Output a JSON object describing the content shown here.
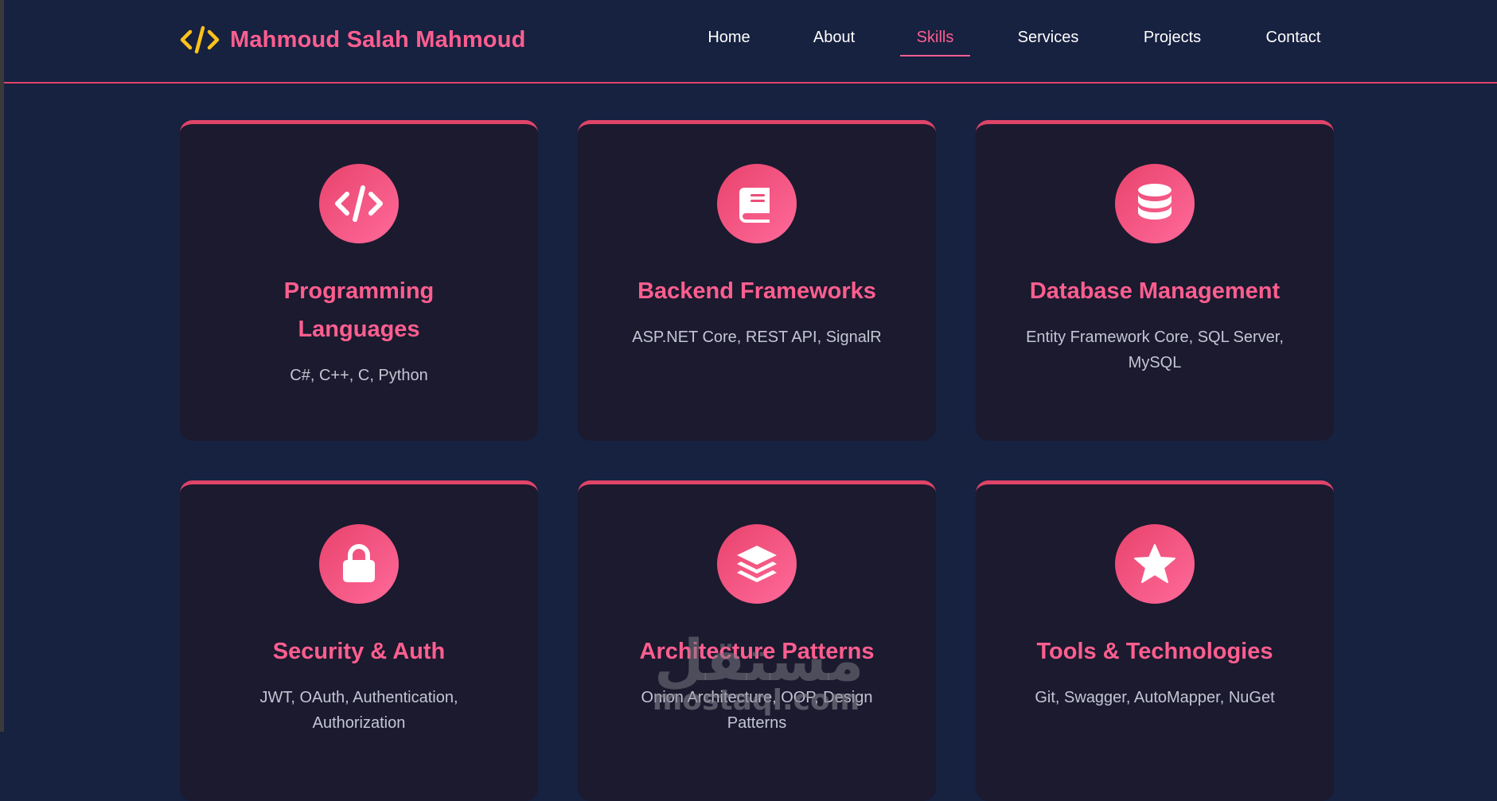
{
  "brand": {
    "name": "Mahmoud Salah Mahmoud",
    "icon": "code-icon",
    "color": "#ff5e8f",
    "icon_color": "#ffc21a"
  },
  "nav": {
    "items": [
      {
        "label": "Home"
      },
      {
        "label": "About"
      },
      {
        "label": "Skills"
      },
      {
        "label": "Services"
      },
      {
        "label": "Projects"
      },
      {
        "label": "Contact"
      }
    ],
    "active": "Skills"
  },
  "colors": {
    "background": "#172140",
    "card": "#1b1a2f",
    "accent": "#ff5e8f",
    "accent_border": "#e04468",
    "text_muted": "#c4c6d2"
  },
  "skills": [
    {
      "title": "Programming Languages",
      "description": "C#, C++, C, Python",
      "icon": "code-icon"
    },
    {
      "title": "Backend Frameworks",
      "description": "ASP.NET Core, REST API, SignalR",
      "icon": "book-icon"
    },
    {
      "title": "Database Management",
      "description": "Entity Framework Core, SQL Server, MySQL",
      "icon": "database-icon"
    },
    {
      "title": "Security & Auth",
      "description": "JWT, OAuth, Authentication, Authorization",
      "icon": "lock-icon"
    },
    {
      "title": "Architecture Patterns",
      "description": "Onion Architecture, OOP, Design Patterns",
      "icon": "layers-icon"
    },
    {
      "title": "Tools & Technologies",
      "description": "Git, Swagger, AutoMapper, NuGet",
      "icon": "star-icon"
    }
  ],
  "watermark": {
    "arabic": "مستقل",
    "latin": "mostaql.com"
  }
}
